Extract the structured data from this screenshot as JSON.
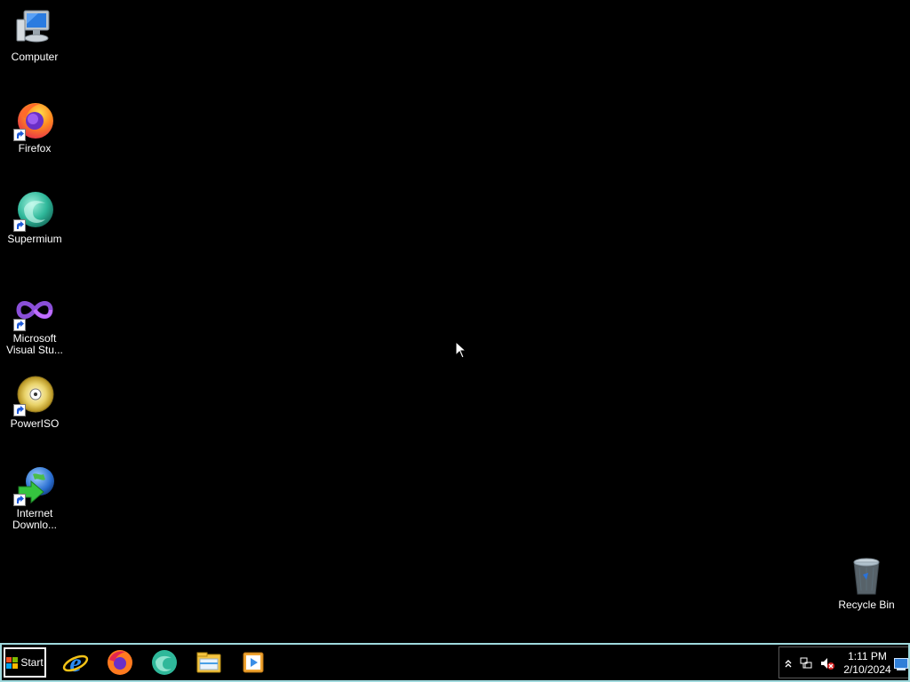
{
  "desktop": {
    "icons": [
      {
        "label": "Computer",
        "icon": "computer-icon"
      },
      {
        "label": "Firefox",
        "icon": "firefox-icon",
        "shortcut": true
      },
      {
        "label": "Supermium",
        "icon": "supermium-icon",
        "shortcut": true
      },
      {
        "label": "Microsoft Visual Stu...",
        "icon": "visual-studio-icon",
        "shortcut": true
      },
      {
        "label": "PowerISO",
        "icon": "poweriso-icon",
        "shortcut": true
      },
      {
        "label": "Internet Downlo...",
        "icon": "internet-download-manager-icon",
        "shortcut": true
      }
    ],
    "recycle_bin": {
      "label": "Recycle Bin",
      "icon": "recycle-bin-icon"
    }
  },
  "taskbar": {
    "start_label": "Start",
    "pinned": [
      "internet-explorer-icon",
      "firefox-icon",
      "supermium-icon",
      "file-explorer-icon",
      "media-player-icon"
    ],
    "tray": {
      "icons": [
        "show-hidden-icons-chevron-icon",
        "network-icon",
        "volume-muted-icon"
      ],
      "time": "1:11 PM",
      "date": "2/10/2024"
    }
  },
  "colors": {
    "background": "#000000",
    "taskbar_border": "#9fd9dd",
    "text": "#ffffff"
  }
}
